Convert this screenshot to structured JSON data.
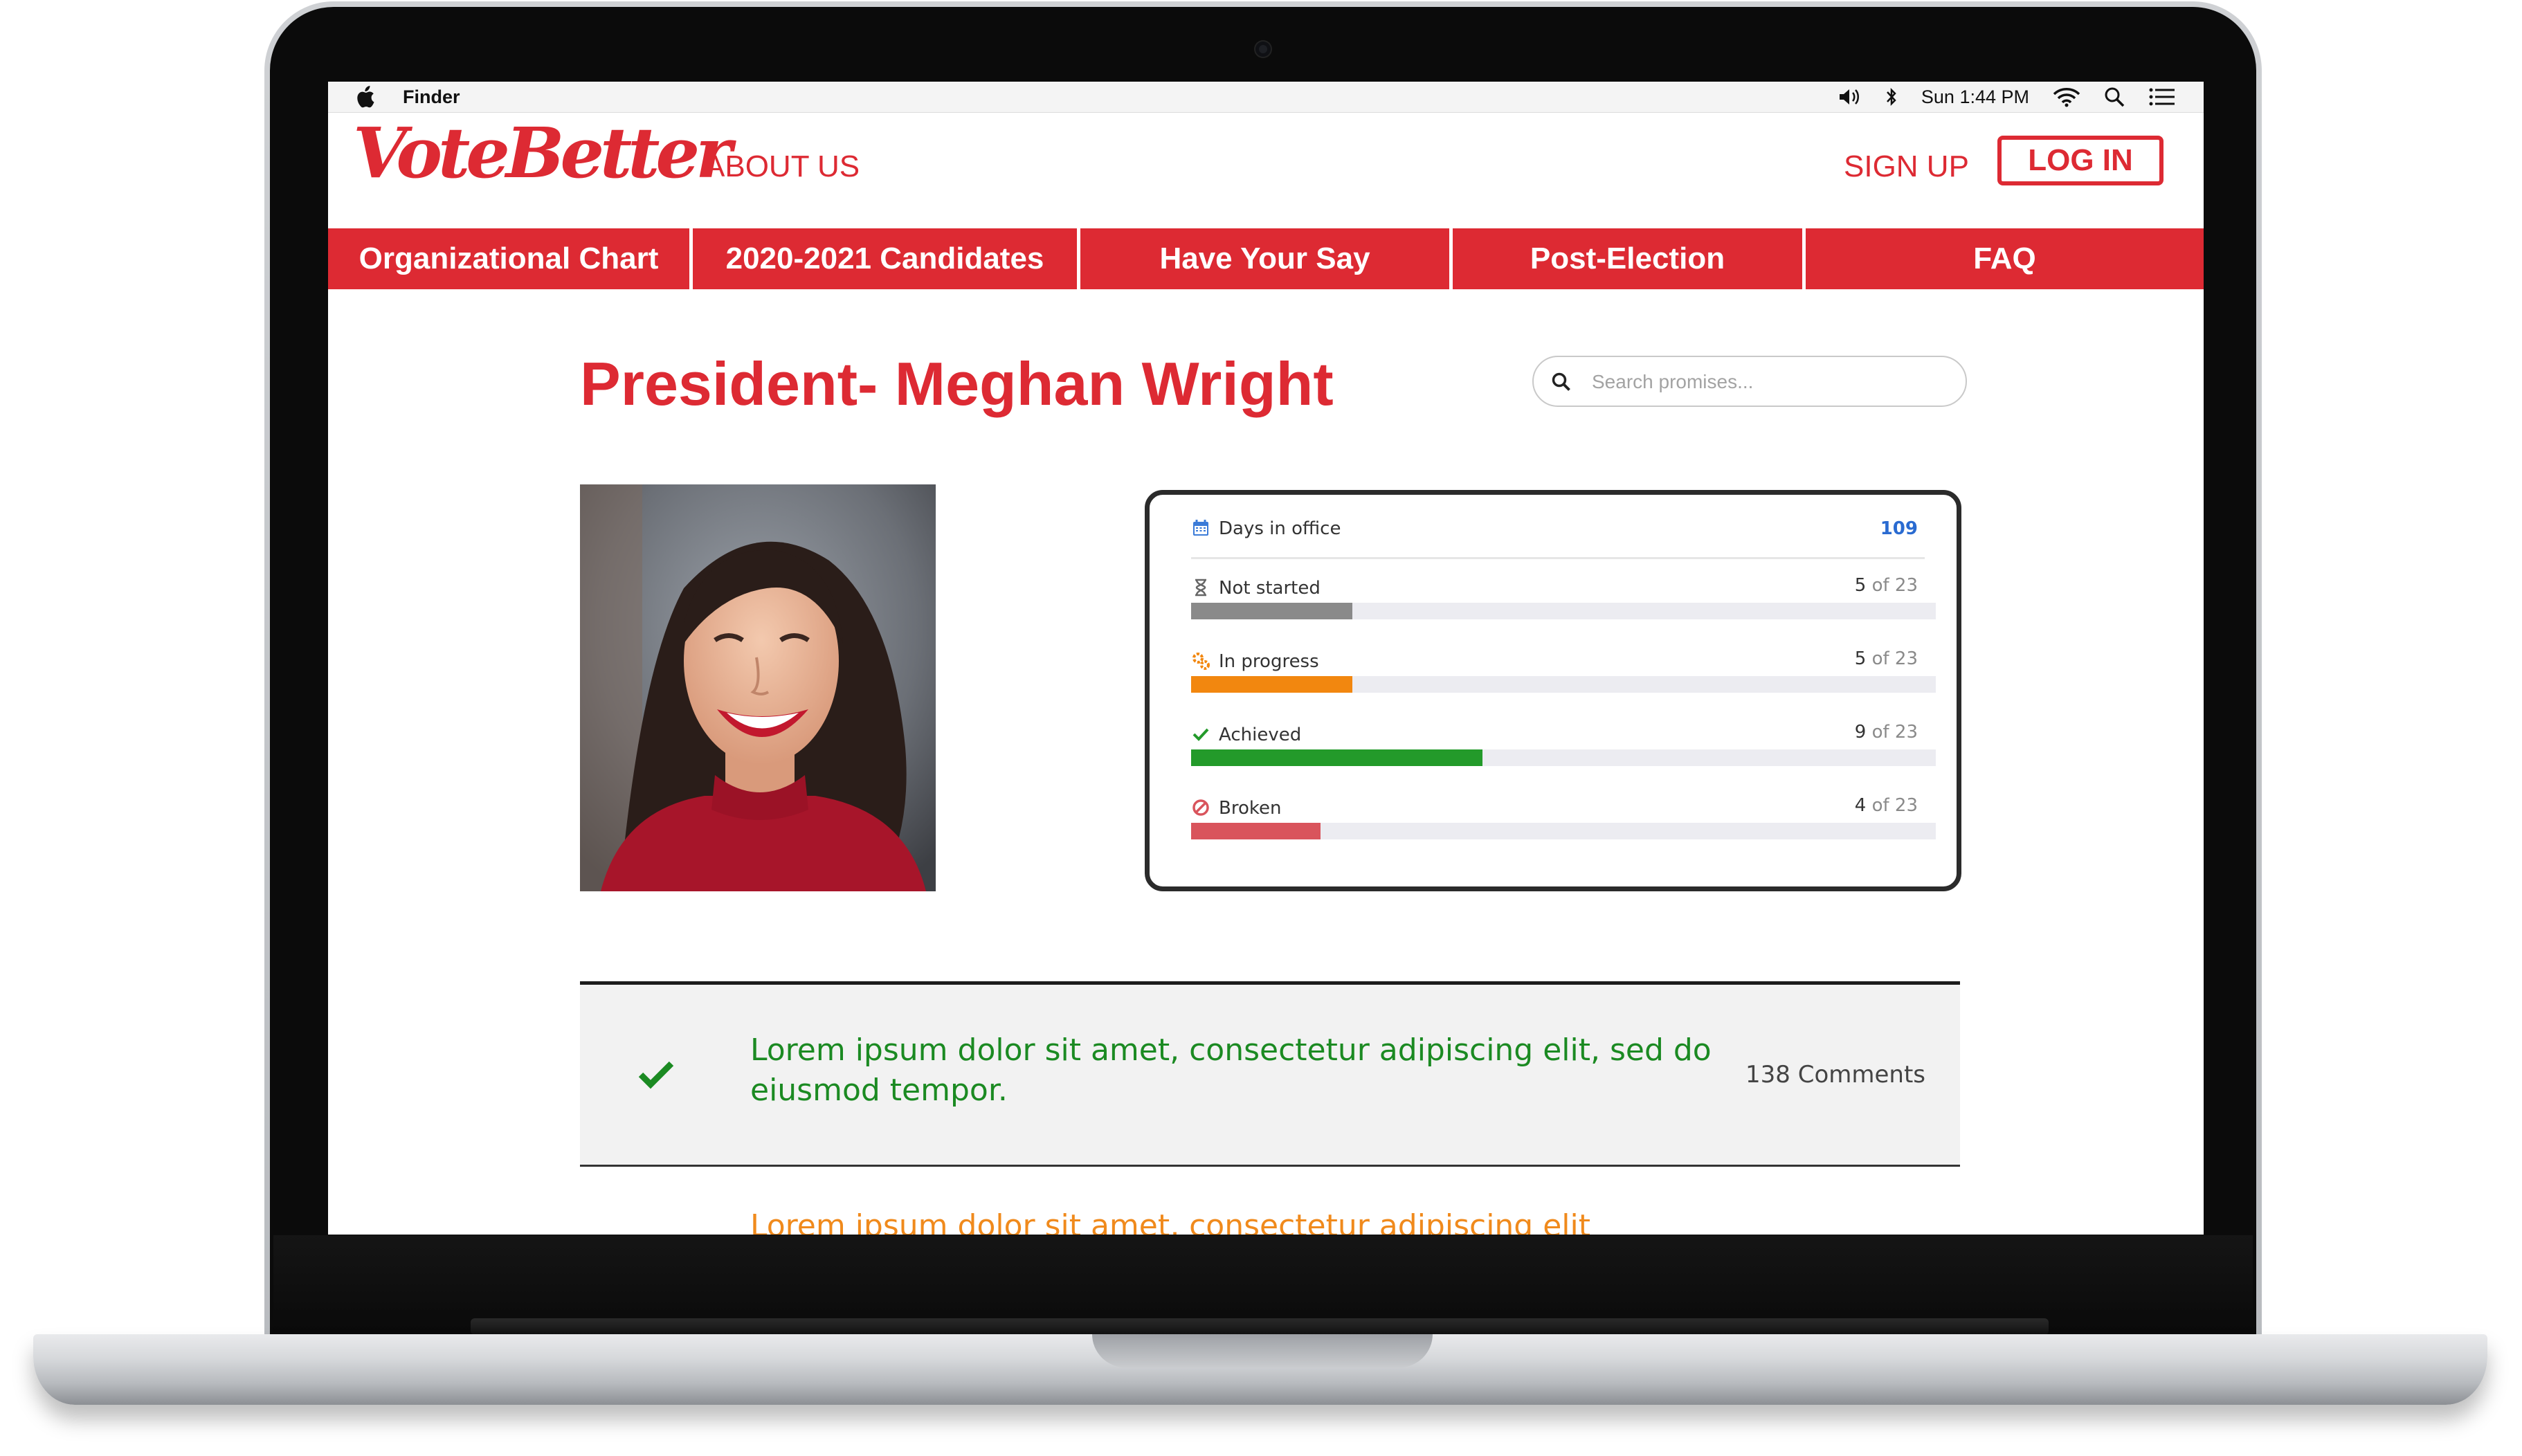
{
  "menubar": {
    "app_name": "Finder",
    "clock": "Sun 1:44 PM"
  },
  "site": {
    "logo": "VoteBetter",
    "about": "ABOUT US",
    "sign_up": "SIGN UP",
    "log_in": "LOG IN",
    "brand_color": "#dd2a33"
  },
  "nav": {
    "items": [
      {
        "label": "Organizational Chart"
      },
      {
        "label": "2020-2021 Candidates"
      },
      {
        "label": "Have Your Say"
      },
      {
        "label": "Post-Election"
      },
      {
        "label": "FAQ"
      }
    ]
  },
  "page": {
    "title": "President- Meghan Wright"
  },
  "search": {
    "placeholder": "Search promises..."
  },
  "stats": {
    "days_label": "Days in office",
    "days_value": "109",
    "rows": [
      {
        "label": "Not started",
        "count": "5",
        "of": "of 23",
        "fraction": 0.217,
        "color": "#8a8a8a",
        "icon": "hourglass-icon"
      },
      {
        "label": "In progress",
        "count": "5",
        "of": "of 23",
        "fraction": 0.217,
        "color": "#f2870f",
        "icon": "cogs-icon"
      },
      {
        "label": "Achieved",
        "count": "9",
        "of": "of 23",
        "fraction": 0.391,
        "color": "#239a2a",
        "icon": "check-icon"
      },
      {
        "label": "Broken",
        "count": "4",
        "of": "of 23",
        "fraction": 0.174,
        "color": "#d9545c",
        "icon": "ban-icon"
      }
    ]
  },
  "promises": [
    {
      "text": "Lorem ipsum dolor sit amet, consectetur adipiscing elit, sed do eiusmod tempor.",
      "comments": "138 Comments",
      "status": "achieved",
      "color": "#1b8a22"
    },
    {
      "text": "Lorem ipsum dolor sit amet, consectetur adipiscing elit",
      "status": "in-progress",
      "color": "#f08a1c"
    }
  ]
}
